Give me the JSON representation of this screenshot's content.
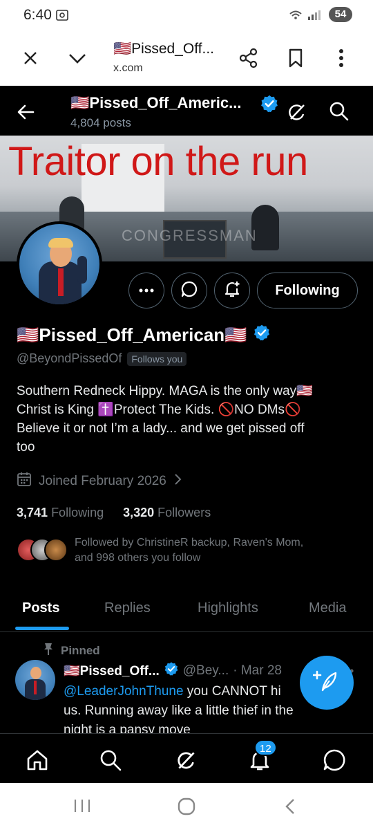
{
  "status_bar": {
    "time": "6:40",
    "battery": "54"
  },
  "browser": {
    "title": "🇺🇸Pissed_Off...",
    "url": "x.com"
  },
  "header": {
    "name": "🇺🇸Pissed_Off_Americ...",
    "posts_count": "4,804 posts"
  },
  "banner": {
    "headline": "Traitor on the run",
    "watermark": "CONGRESSMAN"
  },
  "profile": {
    "display_name": "🇺🇸Pissed_Off_American🇺🇸",
    "handle": "@BeyondPissedOf",
    "follows_you": "Follows you",
    "following_button": "Following",
    "bio_lines": [
      "Southern Redneck Hippy. MAGA is the only way🇺🇸",
      "Christ is King ✝️Protect The Kids. 🚫NO DMs🚫",
      "Believe it or not I’m a lady... and we get pissed off",
      "too"
    ],
    "joined": "Joined February 2026",
    "following_count": "3,741",
    "following_label": "Following",
    "followers_count": "3,320",
    "followers_label": "Followers",
    "followed_by_line1": "Followed by ChristineR backup, Raven's Mom,",
    "followed_by_line2": "and 998 others you follow"
  },
  "tabs": [
    "Posts",
    "Replies",
    "Highlights",
    "Media"
  ],
  "active_tab": "Posts",
  "pinned_post": {
    "pinned_label": "Pinned",
    "author": "🇺🇸Pissed_Off...",
    "handle": "@Bey...",
    "date": "· Mar 28",
    "mention": "@LeaderJohnThune",
    "text_line1_rest": " you CANNOT hi",
    "text_line2": "us. Running away like a little thief in the",
    "text_line3": "night is a pansy move"
  },
  "bottom_nav": {
    "notifications_badge": "12"
  },
  "colors": {
    "accent": "#1d9bf0",
    "background": "#000000",
    "muted": "#71767b",
    "banner_text": "#d01818"
  },
  "icons": {
    "status": [
      "screenshot-icon",
      "wifi-icon",
      "signal-icon"
    ],
    "browser": [
      "close-icon",
      "chevron-down-icon",
      "share-icon",
      "bookmark-icon",
      "more-vertical-icon"
    ],
    "header": [
      "back-arrow-icon",
      "verified-badge-icon",
      "grok-icon",
      "search-icon"
    ],
    "profile_actions": [
      "more-icon",
      "message-icon",
      "notification-add-icon"
    ],
    "bottom_nav": [
      "home-icon",
      "search-icon",
      "grok-icon",
      "bell-icon",
      "chat-icon"
    ],
    "android_nav": [
      "recents-icon",
      "home-circle-icon",
      "back-icon"
    ]
  }
}
